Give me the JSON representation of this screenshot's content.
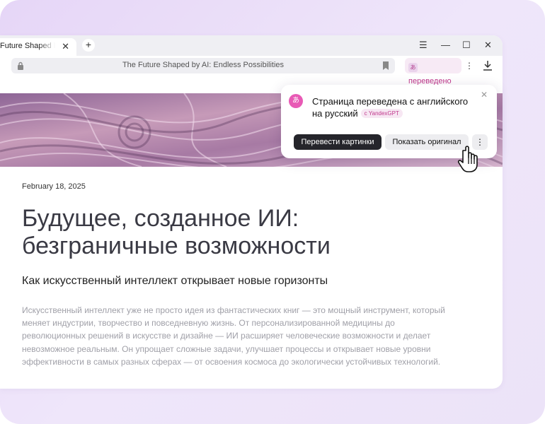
{
  "tab": {
    "title": "Future Shaped by AI",
    "close": "✕"
  },
  "new_tab": "+",
  "window_controls": {
    "menu": "☰",
    "minimize": "—",
    "maximize": "☐",
    "close": "✕"
  },
  "address": {
    "url_text": "The Future Shaped by AI: Endless Possibilities"
  },
  "translate_chip": {
    "glyph": "あ",
    "label": "переведено"
  },
  "more_menu": "⋮",
  "article": {
    "date": "February 18, 2025",
    "headline": "Будущее, созданное ИИ: безграничные возможности",
    "subhead": "Как искусственный интеллект открывает новые горизонты",
    "body": "Искусственный интеллект уже не просто идея из фантастических книг — это мощный инструмент, который меняет индустрии, творчество и повседневную жизнь. От персонализированной медицины до революционных решений в искусстве и дизайне — ИИ расширяет человеческие возможности и делает невозможное реальным. Он упрощает сложные задачи, улучшает процессы и открывает новые уровни эффективности в самых разных сферах — от освоения космоса до экологически устойчивых технологий."
  },
  "popup": {
    "icon": "あ",
    "title": "Страница переведена с английского на русский",
    "badge": "с YandexGPT",
    "close": "✕",
    "translate_images_label": "Перевести картинки",
    "show_original_label": "Показать оригинал",
    "more_label": "⋮"
  },
  "colors": {
    "accent": "#c0398c",
    "dark_button": "#25252b",
    "background_card": "#e6d6f7"
  }
}
